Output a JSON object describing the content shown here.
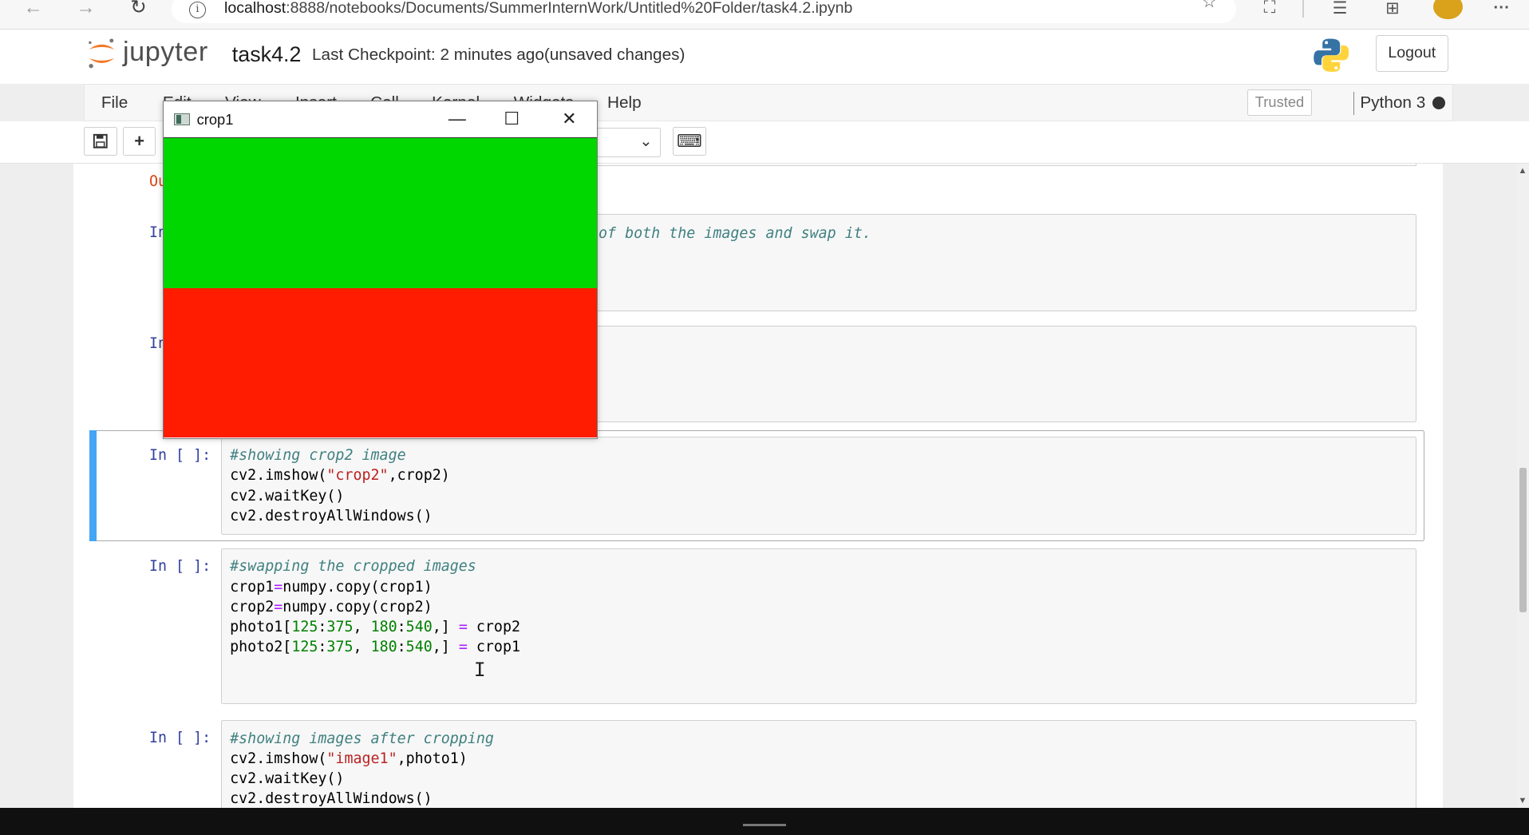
{
  "browser": {
    "back_glyph": "←",
    "forward_glyph": "→",
    "refresh_glyph": "↻",
    "url_host": "localhost",
    "url_rest": ":8888/notebooks/Documents/SummerInternWork/Untitled%20Folder/task4.2.ipynb",
    "more_glyph": "···"
  },
  "jupyter": {
    "logo_text": "jupyter",
    "notebook_name": "task4.2",
    "checkpoint": "Last Checkpoint: 2 minutes ago",
    "unsaved": "(unsaved changes)",
    "logout_label": "Logout"
  },
  "menu": {
    "items": [
      "File",
      "Edit",
      "View",
      "Insert",
      "Cell",
      "Kernel",
      "Widgets",
      "Help"
    ],
    "trusted": "Trusted",
    "kernel": "Python 3"
  },
  "toolbar": {
    "save_glyph": "🖫",
    "add_glyph": "+",
    "keyboard_glyph": "⌨",
    "celltype_chevron": "⌄"
  },
  "cells": {
    "out_prompt": "Ou",
    "in_prompt_partial": "In",
    "cell1_comment_tail": "of both the images and swap it.",
    "cell3": {
      "prompt": "In [ ]:",
      "comment": "#showing crop2 image",
      "line2_a": "cv2.imshow(",
      "line2_str": "\"crop2\"",
      "line2_b": ",crop2)",
      "line3": "cv2.waitKey()",
      "line4": "cv2.destroyAllWindows()"
    },
    "cell4": {
      "prompt": "In [ ]:",
      "comment": "#swapping the cropped images",
      "line2_a": "crop1",
      "line2_op": "=",
      "line2_b": "numpy.copy(crop1)",
      "line3_a": "crop2",
      "line3_op": "=",
      "line3_b": "numpy.copy(crop2)",
      "line4_a": "photo1[",
      "line4_n1": "125",
      "line4_c1": ":",
      "line4_n2": "375",
      "line4_c2": ", ",
      "line4_n3": "180",
      "line4_c3": ":",
      "line4_n4": "540",
      "line4_c4": ",] ",
      "line4_op": "=",
      "line4_end": " crop2",
      "line5_a": "photo2[",
      "line5_n1": "125",
      "line5_c1": ":",
      "line5_n2": "375",
      "line5_c2": ", ",
      "line5_n3": "180",
      "line5_c3": ":",
      "line5_n4": "540",
      "line5_c4": ",] ",
      "line5_op": "=",
      "line5_end": " crop1"
    },
    "cell5": {
      "prompt": "In [ ]:",
      "comment": "#showing images after cropping",
      "line2_a": "cv2.imshow(",
      "line2_str": "\"image1\"",
      "line2_b": ",photo1)",
      "line3": "cv2.waitKey()",
      "line4": "cv2.destroyAllWindows()"
    }
  },
  "cv_window": {
    "title": "crop1",
    "minimize_glyph": "—",
    "maximize_glyph": "☐",
    "close_glyph": "✕",
    "top_color": "#00d600",
    "bottom_color": "#ff1c00"
  },
  "cursor": {
    "glyph": "I"
  }
}
